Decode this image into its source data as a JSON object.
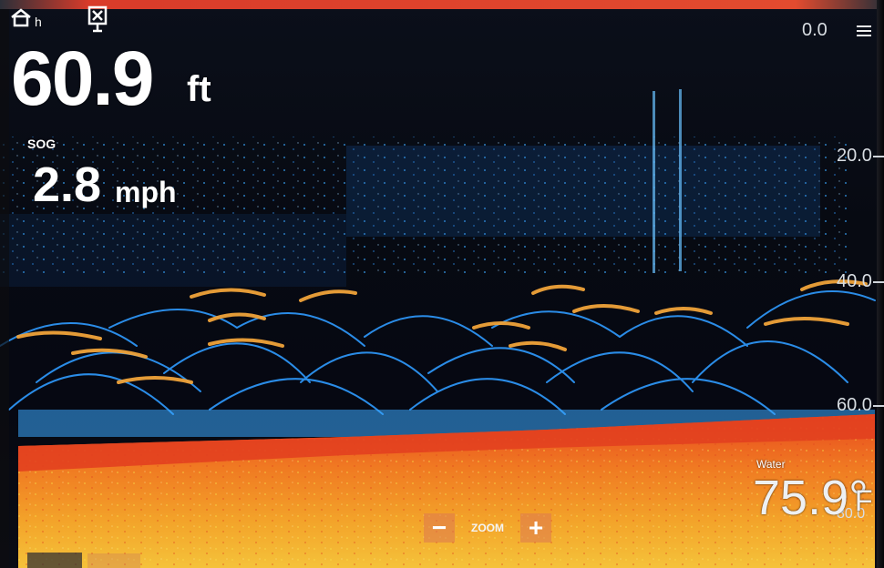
{
  "depth": {
    "value": "60.9",
    "unit": "ft"
  },
  "sog": {
    "label": "SOG",
    "value": "2.8",
    "unit": "mph"
  },
  "scale": {
    "labels": [
      "0.0",
      "20.0",
      "40.0",
      "60.0",
      "80.0"
    ]
  },
  "water": {
    "label": "Water",
    "temp": "75.9°",
    "unit": "F"
  },
  "zoom": {
    "label": "ZOOM",
    "minus": "−",
    "plus": "+"
  },
  "home": {
    "label": "h"
  },
  "colors": {
    "seabed": "#e2401f",
    "sediment": "#f2a12a",
    "echo": "#1e8ff0",
    "background": "#070a12"
  },
  "icons": {
    "home": "home-icon",
    "flag": "waypoint-flag-icon",
    "menu": "menu-icon"
  }
}
